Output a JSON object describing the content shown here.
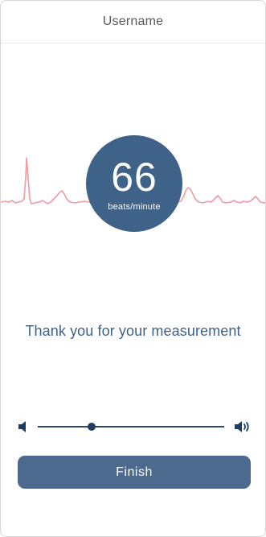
{
  "header": {
    "title": "Username"
  },
  "heart_rate": {
    "value": "66",
    "unit": "beats/minute"
  },
  "message": "Thank you for your measurement",
  "volume": {
    "level": 0.29,
    "low_icon": "speaker-low-icon",
    "high_icon": "speaker-high-icon"
  },
  "finish_button": {
    "label": "Finish"
  },
  "colors": {
    "accent": "#3f6289",
    "button": "#4b6a8e",
    "ecg_line": "#f29aa3"
  }
}
